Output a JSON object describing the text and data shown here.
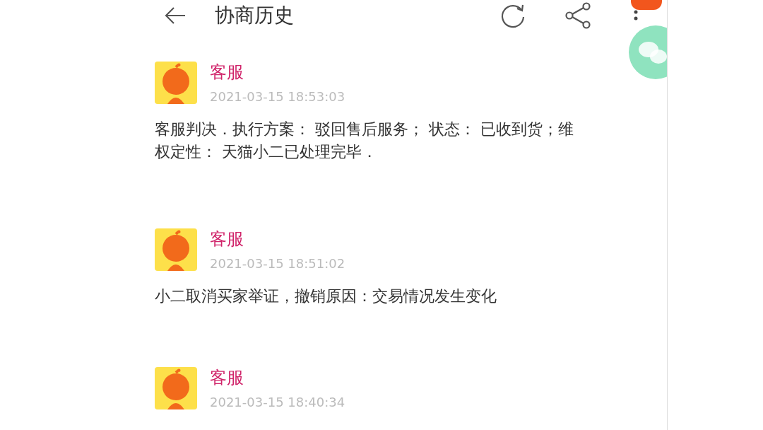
{
  "header": {
    "title": "协商历史"
  },
  "messages": [
    {
      "name": "客服",
      "time": "2021-03-15 18:53:03",
      "text": "客服判决．执行方案： 驳回售后服务； 状态： 已收到货；维权定性： 天猫小二已处理完毕．"
    },
    {
      "name": "客服",
      "time": "2021-03-15 18:51:02",
      "text": "小二取消买家举证，撤销原因：交易情况发生变化"
    },
    {
      "name": "客服",
      "time": "2021-03-15 18:40:34"
    }
  ]
}
